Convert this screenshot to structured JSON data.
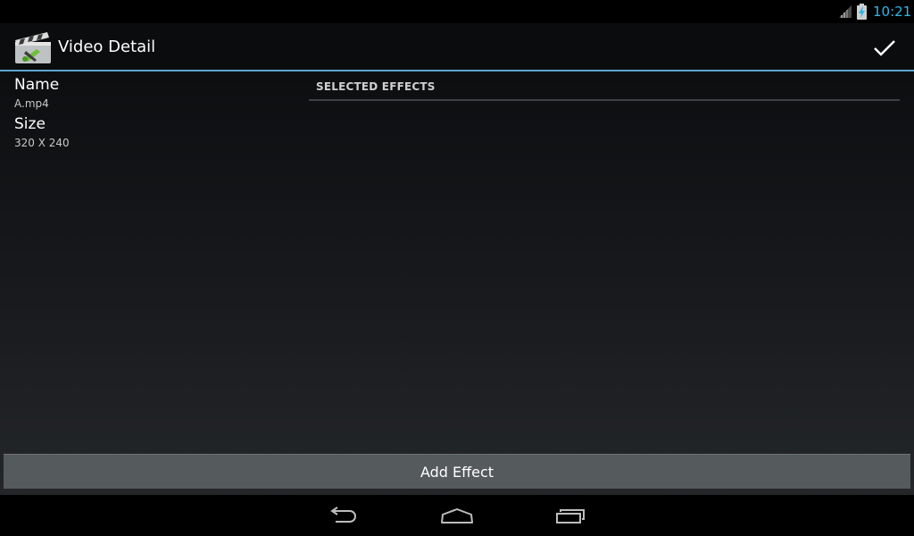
{
  "status_bar": {
    "time": "10:21",
    "signal_icon": "signal-icon",
    "battery_icon": "battery-charging-icon",
    "accent_color": "#33b5e5"
  },
  "action_bar": {
    "title": "Video Detail",
    "app_icon": "clapperboard-icon",
    "done_icon": "checkmark-icon",
    "divider_color": "#5ea6cf"
  },
  "details": {
    "name_label": "Name",
    "name_value": "A.mp4",
    "size_label": "Size",
    "size_value": "320 X 240"
  },
  "effects": {
    "header": "SELECTED EFFECTS"
  },
  "footer": {
    "add_effect_label": "Add Effect"
  },
  "nav_bar": {
    "back_icon": "back-icon",
    "home_icon": "home-icon",
    "recents_icon": "recent-apps-icon"
  }
}
